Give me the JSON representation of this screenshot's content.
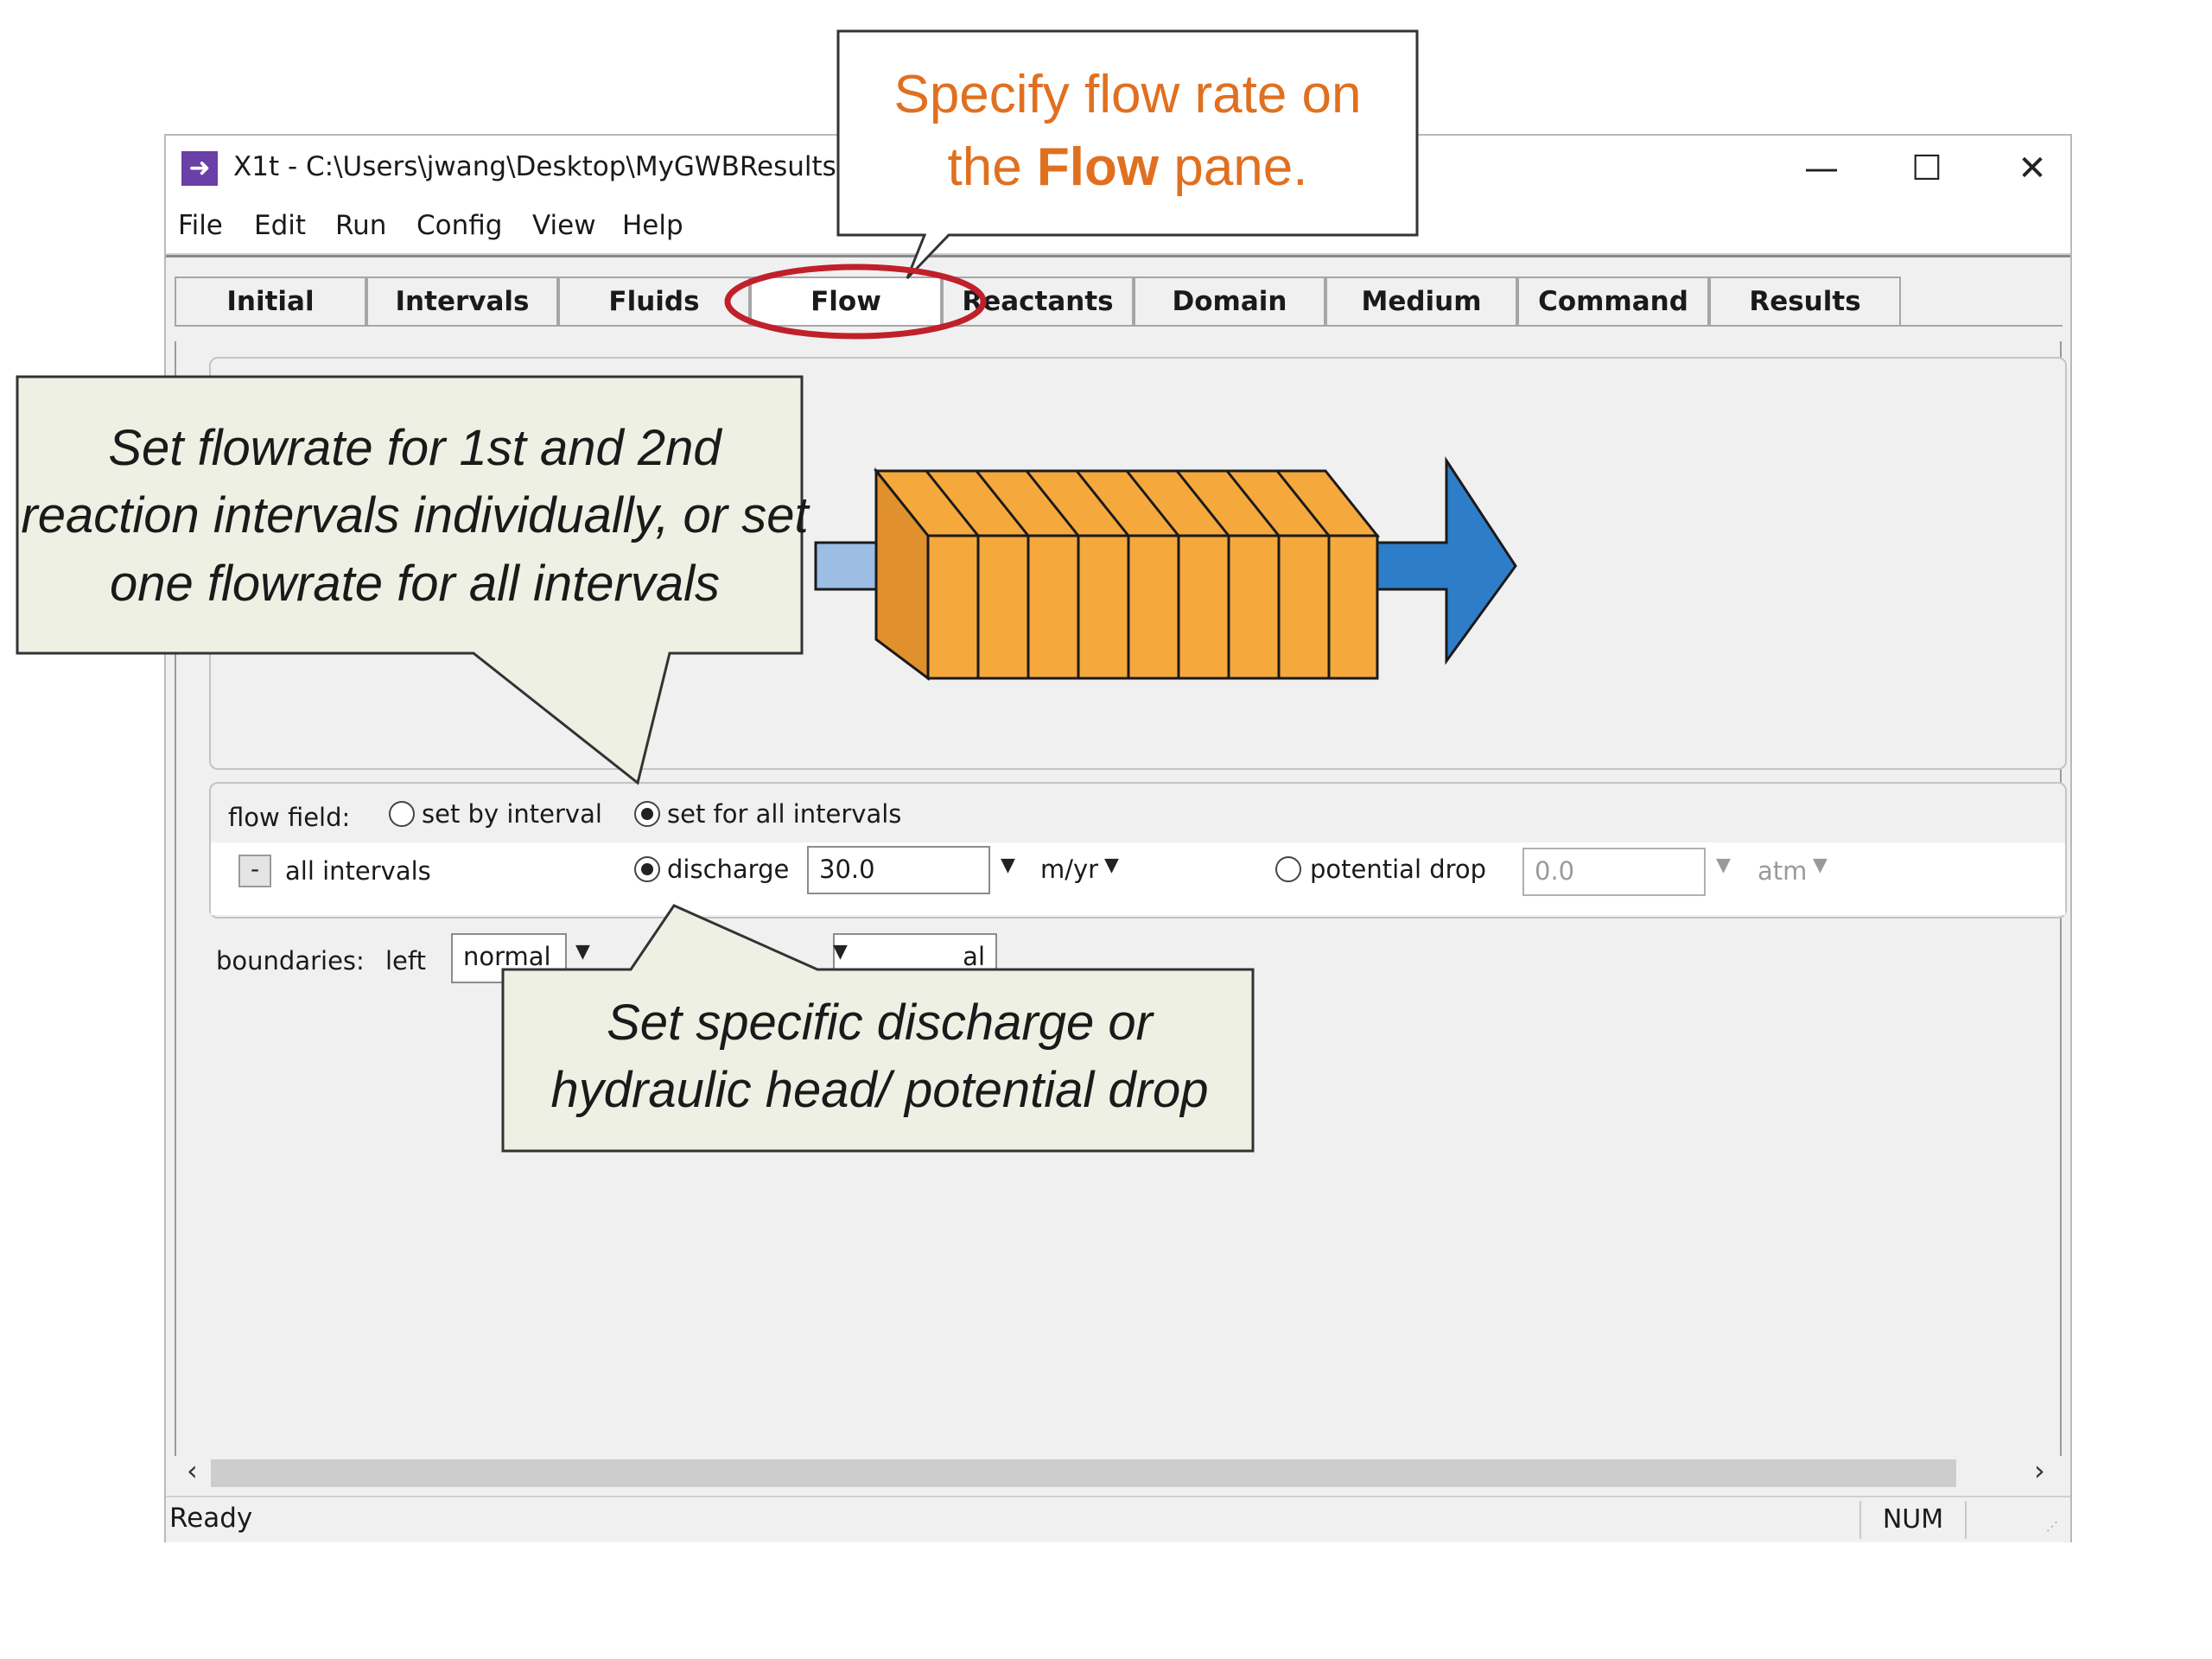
{
  "window": {
    "title": "X1t - C:\\Users\\jwang\\Desktop\\MyGWBResults",
    "controls": {
      "minimize": "—",
      "maximize": "☐",
      "close": "✕"
    }
  },
  "menu": [
    "File",
    "Edit",
    "Run",
    "Config",
    "View",
    "Help"
  ],
  "tabs": [
    "Initial",
    "Intervals",
    "Fluids",
    "Flow",
    "Reactants",
    "Domain",
    "Medium",
    "Command",
    "Results"
  ],
  "active_tab": "Flow",
  "flow_field": {
    "label": "flow field:",
    "option_interval": "set by interval",
    "option_all": "set for all intervals",
    "selected": "set for all intervals"
  },
  "interval_row": {
    "collapse": "-",
    "label": "all intervals",
    "discharge_label": "discharge",
    "discharge_value": "30.0",
    "discharge_unit": "m/yr",
    "potential_label": "potential drop",
    "potential_value": "0.0",
    "potential_unit": "atm"
  },
  "boundaries": {
    "label": "boundaries:",
    "left_label": "left",
    "left_value": "normal",
    "right_value_partial": "al"
  },
  "status": {
    "text": "Ready",
    "num": "NUM"
  },
  "callouts": {
    "flow_pane_pre": "Specify flow rate on",
    "flow_pane_the": "the ",
    "flow_pane_bold": "Flow",
    "flow_pane_post": " pane.",
    "flowrate": "Set flowrate for 1st and 2nd reaction intervals individually, or set one flowrate for all intervals",
    "discharge": "Set specific discharge or hydraulic head/ potential drop"
  },
  "colors": {
    "callout_orange": "#e07020",
    "callout_green_bg": "#eef0e4",
    "highlight_red": "#c0202a",
    "column_orange": "#f5a83c",
    "arrow_blue": "#2e7dc8",
    "inlet_blue": "#9cbde4"
  }
}
